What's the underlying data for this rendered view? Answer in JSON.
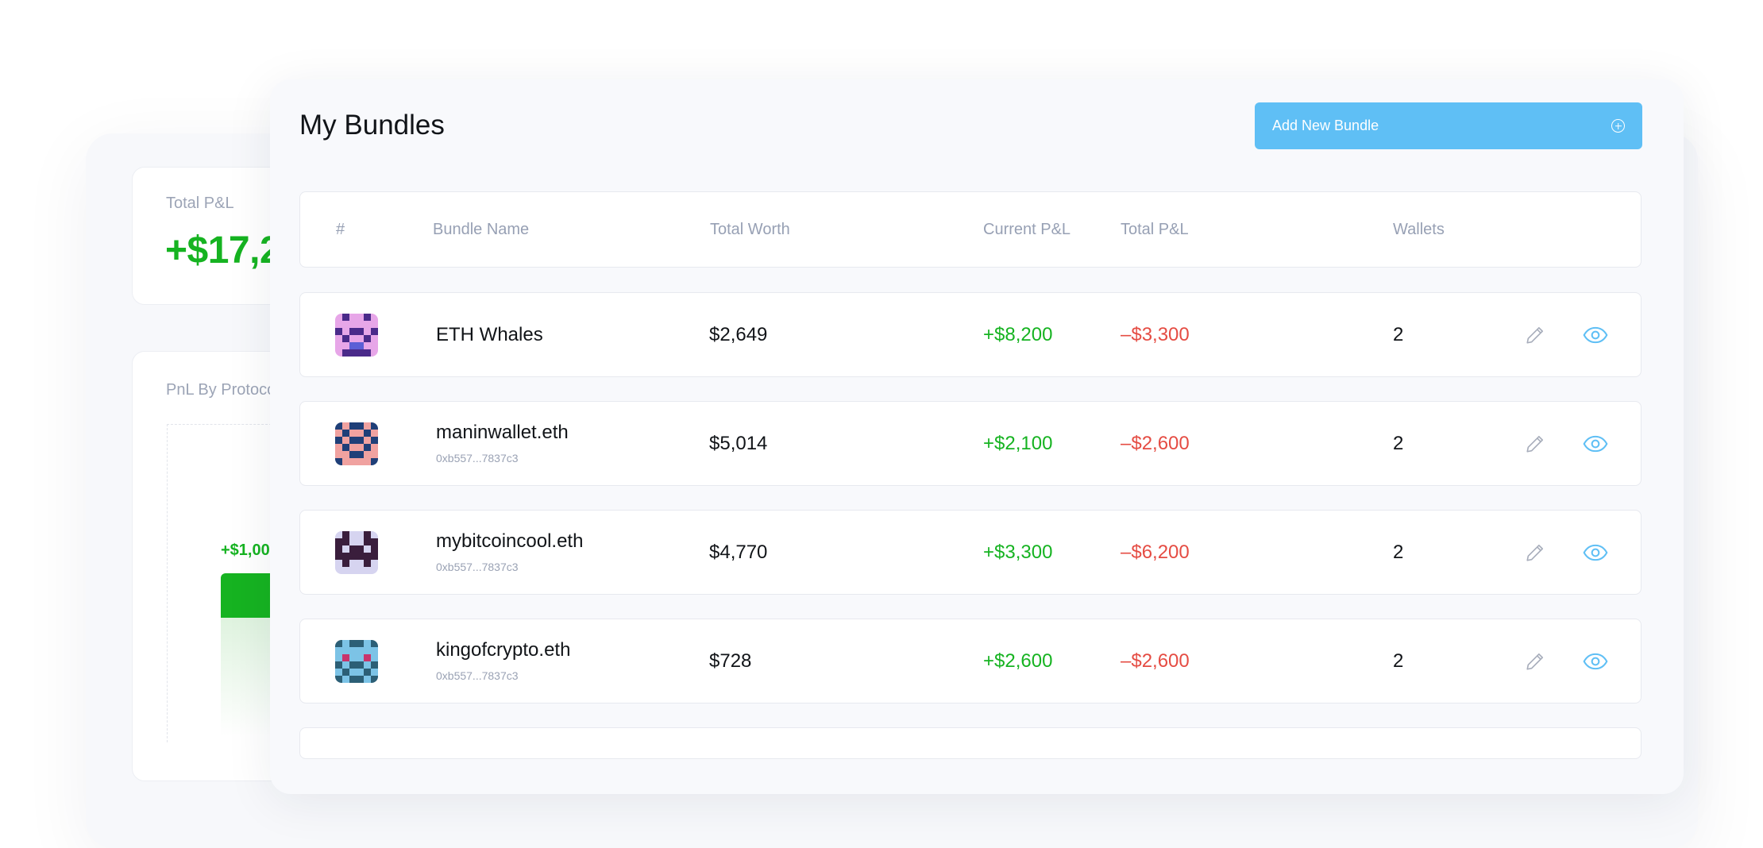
{
  "background": {
    "total_pnl_label": "Total P&L",
    "total_pnl_value": "+$17,2",
    "protocol_label": "PnL By Protoco",
    "chart_value_label": "+$1,00"
  },
  "header": {
    "title": "My Bundles",
    "add_button_label": "Add New Bundle",
    "add_button_icon": "plus-circle-icon"
  },
  "table": {
    "columns": [
      "#",
      "Bundle Name",
      "Total Worth",
      "Current P&L",
      "Total P&L",
      "Wallets"
    ],
    "rows": [
      {
        "name": "ETH Whales",
        "address": "",
        "total_worth": "$2,649",
        "current_pnl": "+$8,200",
        "total_pnl": "–$3,300",
        "wallets": "2"
      },
      {
        "name": "maninwallet.eth",
        "address": "0xb557...7837c3",
        "total_worth": "$5,014",
        "current_pnl": "+$2,100",
        "total_pnl": "–$2,600",
        "wallets": "2"
      },
      {
        "name": "mybitcoincool.eth",
        "address": "0xb557...7837c3",
        "total_worth": "$4,770",
        "current_pnl": "+$3,300",
        "total_pnl": "–$6,200",
        "wallets": "2"
      },
      {
        "name": "kingofcrypto.eth",
        "address": "0xb557...7837c3",
        "total_worth": "$728",
        "current_pnl": "+$2,600",
        "total_pnl": "–$2,600",
        "wallets": "2"
      }
    ],
    "row_actions": [
      "pencil-icon",
      "eye-icon"
    ]
  },
  "colors": {
    "accent": "#5fbff5",
    "positive": "#16b321",
    "negative": "#e54c43",
    "muted": "#97a0b4"
  }
}
